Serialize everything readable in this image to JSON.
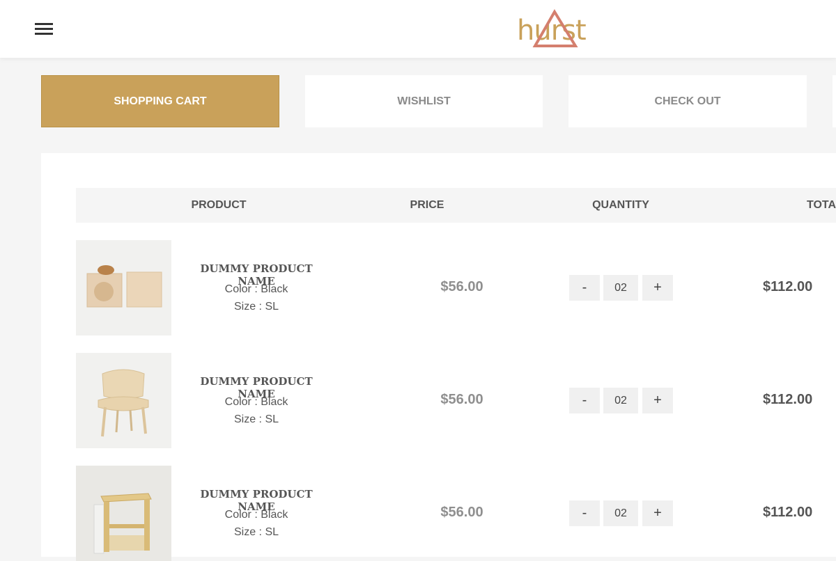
{
  "header": {
    "logo_text": "hurst",
    "logo_colors": {
      "word": "#c9a15a",
      "triangle": "#d47f6e"
    }
  },
  "tabs": [
    {
      "label": "SHOPPING CART",
      "active": true
    },
    {
      "label": "WISHLIST",
      "active": false
    },
    {
      "label": "CHECK OUT",
      "active": false
    }
  ],
  "table": {
    "headers": {
      "product": "PRODUCT",
      "price": "PRICE",
      "quantity": "QUANTITY",
      "total": "TOTAL"
    },
    "rows": [
      {
        "name": "DUMMY PRODUCT NAME",
        "color": "Color : Black",
        "size": "Size : SL",
        "price": "$56.00",
        "qty": "02",
        "minus": "-",
        "plus": "+",
        "total": "$112.00",
        "image": "wooden-blocks-image"
      },
      {
        "name": "DUMMY PRODUCT NAME",
        "color": "Color : Black",
        "size": "Size : SL",
        "price": "$56.00",
        "qty": "02",
        "minus": "-",
        "plus": "+",
        "total": "$112.00",
        "image": "wooden-chair-image"
      },
      {
        "name": "DUMMY PRODUCT NAME",
        "color": "Color : Black",
        "size": "Size : SL",
        "price": "$56.00",
        "qty": "02",
        "minus": "-",
        "plus": "+",
        "total": "$112.00",
        "image": "wooden-stool-image"
      }
    ]
  },
  "colors": {
    "accent": "#c9a15a",
    "page_bg": "#f5f5f5"
  }
}
